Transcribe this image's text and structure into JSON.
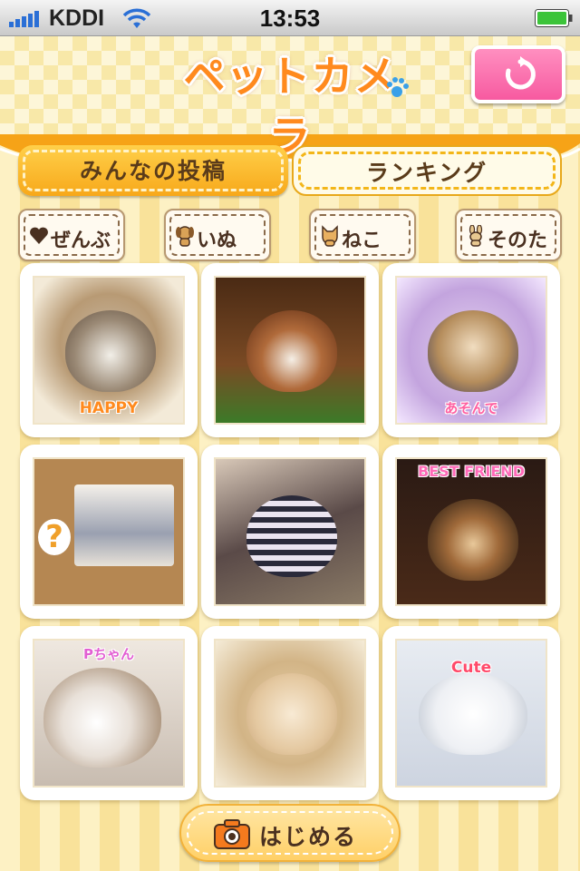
{
  "status_bar": {
    "carrier": "KDDI",
    "time": "13:53"
  },
  "header": {
    "logo_text": "ペットカメラ",
    "refresh_icon": "refresh-icon"
  },
  "tabs": [
    {
      "label": "みんなの投稿",
      "active": true
    },
    {
      "label": "ランキング",
      "active": false
    }
  ],
  "filters": [
    {
      "label": "ぜんぶ",
      "icon": "heart-icon"
    },
    {
      "label": "いぬ",
      "icon": "dog-icon"
    },
    {
      "label": "ねこ",
      "icon": "cat-icon"
    },
    {
      "label": "そのた",
      "icon": "rabbit-icon"
    }
  ],
  "photos": [
    {
      "caption": "HAPPY",
      "position": "bottom"
    },
    {
      "caption": "",
      "position": "bottom"
    },
    {
      "caption": "あそんで",
      "position": "bottom"
    },
    {
      "caption": "?",
      "position": "bottom"
    },
    {
      "caption": "",
      "position": "bottom"
    },
    {
      "caption": "BEST FRIEND",
      "position": "top"
    },
    {
      "caption": "Pちゃん",
      "position": "top"
    },
    {
      "caption": "",
      "position": "bottom"
    },
    {
      "caption": "Cute",
      "position": "top"
    }
  ],
  "start_button": {
    "label": "はじめる",
    "icon": "camera-icon"
  },
  "colors": {
    "accent_orange": "#f7a81a",
    "refresh_pink": "#f75aa0",
    "text_brown": "#4a3020"
  }
}
